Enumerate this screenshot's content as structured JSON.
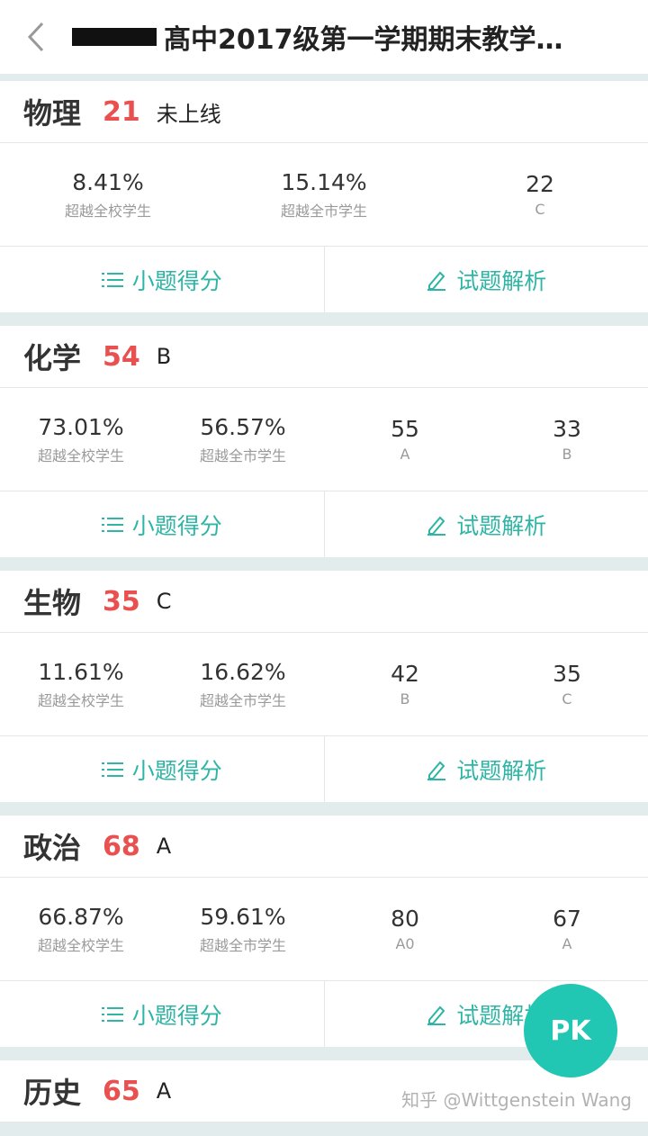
{
  "header": {
    "title": "髙中2017级第一学期期末教学…"
  },
  "labels": {
    "school": "超越全校学生",
    "city": "超越全市学生",
    "detail": "小题得分",
    "analysis": "试题解析"
  },
  "subjects": [
    {
      "name": "物理",
      "score": "21",
      "grade": "未上线",
      "stats": [
        {
          "value": "8.41%",
          "label": "超越全校学生"
        },
        {
          "value": "15.14%",
          "label": "超越全市学生"
        },
        {
          "value": "22",
          "label": "C"
        }
      ]
    },
    {
      "name": "化学",
      "score": "54",
      "grade": "B",
      "stats": [
        {
          "value": "73.01%",
          "label": "超越全校学生"
        },
        {
          "value": "56.57%",
          "label": "超越全市学生"
        },
        {
          "value": "55",
          "label": "A"
        },
        {
          "value": "33",
          "label": "B"
        }
      ]
    },
    {
      "name": "生物",
      "score": "35",
      "grade": "C",
      "stats": [
        {
          "value": "11.61%",
          "label": "超越全校学生"
        },
        {
          "value": "16.62%",
          "label": "超越全市学生"
        },
        {
          "value": "42",
          "label": "B"
        },
        {
          "value": "35",
          "label": "C"
        }
      ]
    },
    {
      "name": "政治",
      "score": "68",
      "grade": "A",
      "stats": [
        {
          "value": "66.87%",
          "label": "超越全校学生"
        },
        {
          "value": "59.61%",
          "label": "超越全市学生"
        },
        {
          "value": "80",
          "label": "A0"
        },
        {
          "value": "67",
          "label": "A"
        }
      ]
    },
    {
      "name": "历史",
      "score": "65",
      "grade": "A"
    }
  ],
  "fab": {
    "label": "PK"
  },
  "watermark": "知乎 @Wittgenstein Wang",
  "colors": {
    "accent": "#2fb5a5",
    "score": "#e8514f",
    "fab": "#22c7b3",
    "page_bg": "#e3ecec"
  }
}
